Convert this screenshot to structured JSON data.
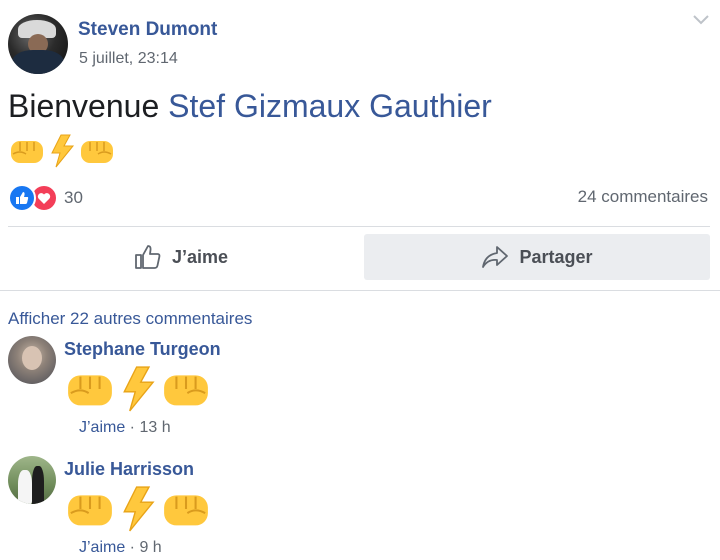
{
  "post": {
    "author": "Steven Dumont",
    "timestamp": "5 juillet, 23:14",
    "text_prefix": "Bienvenue ",
    "mention": "Stef Gizmaux Gauthier",
    "emojis": [
      "fist-icon",
      "lightning-icon",
      "fist-icon"
    ]
  },
  "reactions": {
    "icons": [
      "like-icon",
      "love-icon"
    ],
    "count": "30",
    "comments_count": "24 commentaires"
  },
  "actions": {
    "like_label": "J’aime",
    "share_label": "Partager"
  },
  "comments_section": {
    "more_comments": "Afficher 22 autres commentaires",
    "comments": [
      {
        "author": "Stephane Turgeon",
        "like_label": "J’aime",
        "sep": " · ",
        "time": "13 h"
      },
      {
        "author": "Julie Harrisson",
        "like_label": "J’aime",
        "sep": " · ",
        "time": "9 h"
      }
    ]
  },
  "colors": {
    "link": "#385898",
    "like": "#1877f2",
    "love": "#f33e58",
    "secondary_text": "#606770",
    "emoji_yellow": "#ffc83d"
  }
}
